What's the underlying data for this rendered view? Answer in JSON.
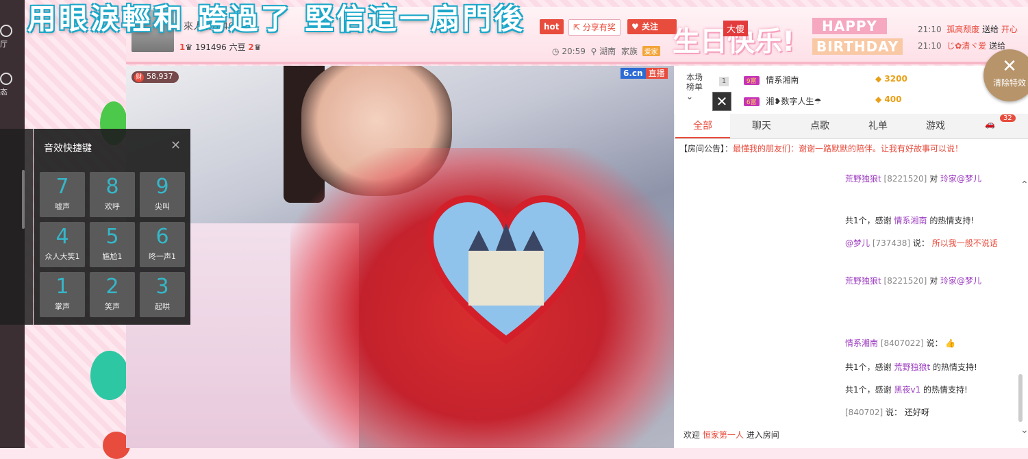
{
  "headline": "用眼淚輕和 跨過了 堅信這一扇門後",
  "leftnav": {
    "items": [
      "厅",
      "态"
    ]
  },
  "header": {
    "anchor_name": "來人傻(840702)",
    "level_text": "191496 六豆",
    "level_left": "1",
    "level_right": "2",
    "time": "20:59",
    "location": "湖南",
    "family_label": "家族",
    "family_badge": "爱家",
    "hot_label": "hot",
    "share_label": "分享有奖",
    "follow_label": "关注",
    "birthday_cn": "生日快乐!",
    "birthday_tag": "大傻",
    "happy": "HAPPY",
    "birthday_en": "BIRTHDAY",
    "gift_log": [
      {
        "time": "21:10",
        "user": "孤高颓废",
        "action": "送给",
        "target": "开心"
      },
      {
        "time": "21:10",
        "user": "じ✿清ヾ爱",
        "action": "送给",
        "target": ""
      }
    ]
  },
  "video": {
    "coin_count": "58,937",
    "coin_icon": "财",
    "site_logo": "6.cn",
    "live_tag": "直播"
  },
  "clear_effects_label": "清除特效",
  "rank": {
    "head": "本场榜单",
    "rows": [
      {
        "no": "1",
        "level": "9富",
        "name": "情系湘南",
        "amount": "3200"
      },
      {
        "no": "",
        "level": "6富",
        "name": "湘❥数字人生☂",
        "amount": "400"
      }
    ]
  },
  "tabs": [
    "全部",
    "聊天",
    "点歌",
    "礼单",
    "游戏"
  ],
  "car_count": "32",
  "notice": {
    "label": "【房间公告】：",
    "text": "最懂我的朋友们：谢谢一路默默的陪伴。让我有好故事可以说！"
  },
  "chat": [
    {
      "user": "荒野独狼t",
      "id": "[8221520]",
      "mid": "对",
      "target": "玲家@梦儿",
      "text": ""
    },
    {
      "user": "",
      "id": "",
      "mid": "共1个，感谢",
      "target": "情系湘南",
      "text": "的热情支持!"
    },
    {
      "user": "@梦儿",
      "id": "[737438]",
      "mid": "说：",
      "target": "",
      "text": "所以我一般不说话"
    },
    {
      "user": "荒野独狼t",
      "id": "[8221520]",
      "mid": "对",
      "target": "玲家@梦儿",
      "text": ""
    },
    {
      "user": "情系湘南",
      "id": "[8407022]",
      "mid": "说：",
      "target": "",
      "text": ""
    },
    {
      "user": "",
      "id": "",
      "mid": "共1个，感谢",
      "target": "荒野独狼t",
      "text": "的热情支持!"
    },
    {
      "user": "",
      "id": "",
      "mid": "共1个，感谢",
      "target": "黑夜v1",
      "text": "的热情支持!"
    },
    {
      "user": "",
      "id": "[840702]",
      "mid": "说：",
      "target": "",
      "text": "还好呀"
    },
    {
      "user": "",
      "id": "",
      "mid": "欢迎",
      "target": "恒家第一人",
      "text": "进入房间"
    }
  ],
  "sfx": {
    "title": "音效快捷键",
    "keys": [
      {
        "n": "7",
        "l": "嘘声"
      },
      {
        "n": "8",
        "l": "欢呼"
      },
      {
        "n": "9",
        "l": "尖叫"
      },
      {
        "n": "4",
        "l": "众人大笑1"
      },
      {
        "n": "5",
        "l": "尴尬1"
      },
      {
        "n": "6",
        "l": "咚一声1"
      },
      {
        "n": "1",
        "l": "掌声"
      },
      {
        "n": "2",
        "l": "笑声"
      },
      {
        "n": "3",
        "l": "起哄"
      }
    ]
  }
}
